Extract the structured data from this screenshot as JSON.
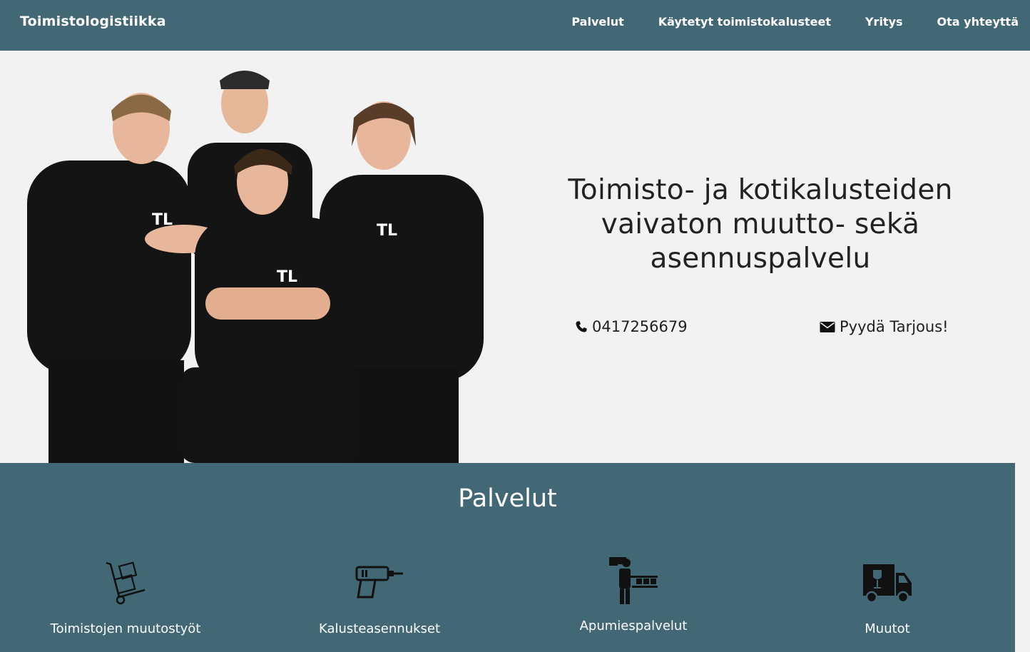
{
  "navbar": {
    "brand": "Toimistologistiikka",
    "links": [
      "Palvelut",
      "Käytetyt toimistokalusteet",
      "Yritys",
      "Ota yhteyttä"
    ]
  },
  "hero": {
    "headline": "Toimisto- ja kotikalusteiden vaivaton muutto- sekä asennuspalvelu",
    "phone": "0417256679",
    "quote_label": "Pyydä Tarjous!",
    "shirt_logo": "TL"
  },
  "services": {
    "title": "Palvelut",
    "items": [
      {
        "label": "Toimistojen muutostyöt",
        "icon": "hand-truck-icon"
      },
      {
        "label": "Kalusteasennukset",
        "icon": "drill-icon"
      },
      {
        "label": "Apumiespalvelut",
        "icon": "worker-icon"
      },
      {
        "label": "Muutot",
        "icon": "moving-truck-icon"
      }
    ]
  },
  "colors": {
    "primary": "#426875",
    "background": "#f2f2f2",
    "text": "#222222",
    "shirt": "#141414"
  }
}
